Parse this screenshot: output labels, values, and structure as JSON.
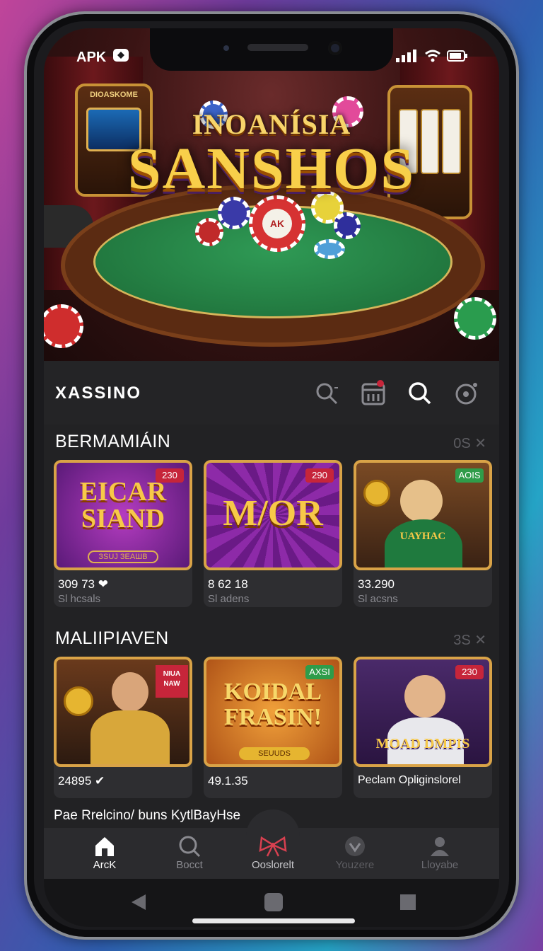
{
  "status_bar": {
    "left_label": "APK"
  },
  "hero": {
    "subtitle": "INOANÍSIA",
    "title": "SANSHOS",
    "left_machine_label": "DIOASKOME",
    "chip_label": "AK"
  },
  "header": {
    "brand": "XASSINO",
    "icons": [
      "search-plus-icon",
      "calendar-icon",
      "search-icon",
      "settings-dot-icon"
    ]
  },
  "sections": [
    {
      "title": "BERMAMIÁIN",
      "meta": "0S ✕",
      "cards": [
        {
          "thumb_text": "EICAR SIAND",
          "caption": "ЗSUJ ЗЕАШВ",
          "badge": "230",
          "value": "309 73 ❤",
          "sub": "Sl hcsals"
        },
        {
          "thumb_text": "M/OR",
          "badge": "290",
          "value": "8 62 18",
          "sub": "Sl adens"
        },
        {
          "thumb_text": "UAYHAC",
          "badge": "AOIS",
          "value": "33.290",
          "sub": "Sl acsns"
        }
      ]
    },
    {
      "title": "MALIIPIAVEN",
      "meta": "3S ✕",
      "cards": [
        {
          "thumb_text": "NIUA NAW",
          "badge": "",
          "value": "24895 ✔",
          "sub": ""
        },
        {
          "thumb_text": "KOIDAL FRASIN!",
          "caption": "SEUUDS",
          "badge": "AXSI",
          "value": "49.1.35",
          "sub": ""
        },
        {
          "thumb_text": "MOAD DMPIS",
          "badge": "230",
          "value": "Peclam Opliginslorel",
          "sub": ""
        }
      ]
    }
  ],
  "footer_text": "Pae Rrelcino/ buns KytlBayHse",
  "nav": [
    {
      "label": "ArcK",
      "icon": "home-icon"
    },
    {
      "label": "Bocct",
      "icon": "search-icon"
    },
    {
      "label": "Ooslorelt",
      "icon": "bow-icon"
    },
    {
      "label": "Youzere",
      "icon": "shield-icon"
    },
    {
      "label": "Lloyabe",
      "icon": "user-icon"
    }
  ],
  "colors": {
    "accent_gold": "#d9a347",
    "badge_red": "#c6253a",
    "badge_green": "#2f9c4a",
    "bg_dark": "#222224"
  }
}
